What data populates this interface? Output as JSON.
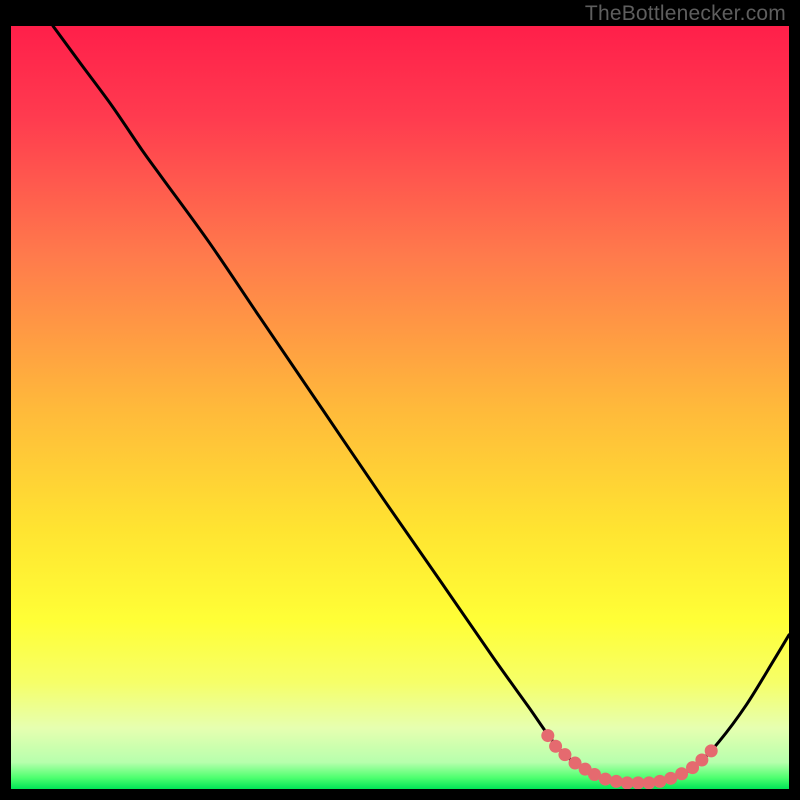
{
  "watermark": "TheBottlenecker.com",
  "chart_data": {
    "type": "line",
    "title": "",
    "xlabel": "",
    "ylabel": "",
    "xlim": [
      0,
      1
    ],
    "ylim": [
      0,
      1
    ],
    "gradient_stops": [
      {
        "offset": 0.0,
        "color": "#ff1f4a"
      },
      {
        "offset": 0.12,
        "color": "#ff3b4f"
      },
      {
        "offset": 0.3,
        "color": "#ff7a4c"
      },
      {
        "offset": 0.5,
        "color": "#ffb93b"
      },
      {
        "offset": 0.66,
        "color": "#ffe431"
      },
      {
        "offset": 0.78,
        "color": "#ffff36"
      },
      {
        "offset": 0.86,
        "color": "#f6ff68"
      },
      {
        "offset": 0.92,
        "color": "#e6ffb0"
      },
      {
        "offset": 0.965,
        "color": "#b7ffad"
      },
      {
        "offset": 0.985,
        "color": "#4fff70"
      },
      {
        "offset": 1.0,
        "color": "#00e556"
      }
    ],
    "series": [
      {
        "name": "curve",
        "stroke": "#000000",
        "stroke_width": 3,
        "points": [
          {
            "x": 0.054,
            "y": 1.0
          },
          {
            "x": 0.09,
            "y": 0.95
          },
          {
            "x": 0.13,
            "y": 0.895
          },
          {
            "x": 0.168,
            "y": 0.838
          },
          {
            "x": 0.195,
            "y": 0.8
          },
          {
            "x": 0.255,
            "y": 0.716
          },
          {
            "x": 0.32,
            "y": 0.618
          },
          {
            "x": 0.4,
            "y": 0.498
          },
          {
            "x": 0.48,
            "y": 0.378
          },
          {
            "x": 0.555,
            "y": 0.268
          },
          {
            "x": 0.62,
            "y": 0.172
          },
          {
            "x": 0.665,
            "y": 0.108
          },
          {
            "x": 0.7,
            "y": 0.058
          },
          {
            "x": 0.73,
            "y": 0.03
          },
          {
            "x": 0.76,
            "y": 0.014
          },
          {
            "x": 0.79,
            "y": 0.008
          },
          {
            "x": 0.82,
            "y": 0.008
          },
          {
            "x": 0.85,
            "y": 0.014
          },
          {
            "x": 0.88,
            "y": 0.03
          },
          {
            "x": 0.91,
            "y": 0.062
          },
          {
            "x": 0.945,
            "y": 0.11
          },
          {
            "x": 0.98,
            "y": 0.168
          },
          {
            "x": 1.0,
            "y": 0.202
          }
        ]
      },
      {
        "name": "highlight-dots",
        "stroke": "#e56a6f",
        "marker_radius": 6.5,
        "points": [
          {
            "x": 0.69,
            "y": 0.07
          },
          {
            "x": 0.7,
            "y": 0.056
          },
          {
            "x": 0.712,
            "y": 0.045
          },
          {
            "x": 0.725,
            "y": 0.034
          },
          {
            "x": 0.738,
            "y": 0.026
          },
          {
            "x": 0.75,
            "y": 0.019
          },
          {
            "x": 0.764,
            "y": 0.013
          },
          {
            "x": 0.778,
            "y": 0.01
          },
          {
            "x": 0.792,
            "y": 0.008
          },
          {
            "x": 0.806,
            "y": 0.008
          },
          {
            "x": 0.82,
            "y": 0.008
          },
          {
            "x": 0.834,
            "y": 0.01
          },
          {
            "x": 0.848,
            "y": 0.014
          },
          {
            "x": 0.862,
            "y": 0.02
          },
          {
            "x": 0.876,
            "y": 0.028
          },
          {
            "x": 0.888,
            "y": 0.038
          },
          {
            "x": 0.9,
            "y": 0.05
          }
        ]
      }
    ]
  }
}
